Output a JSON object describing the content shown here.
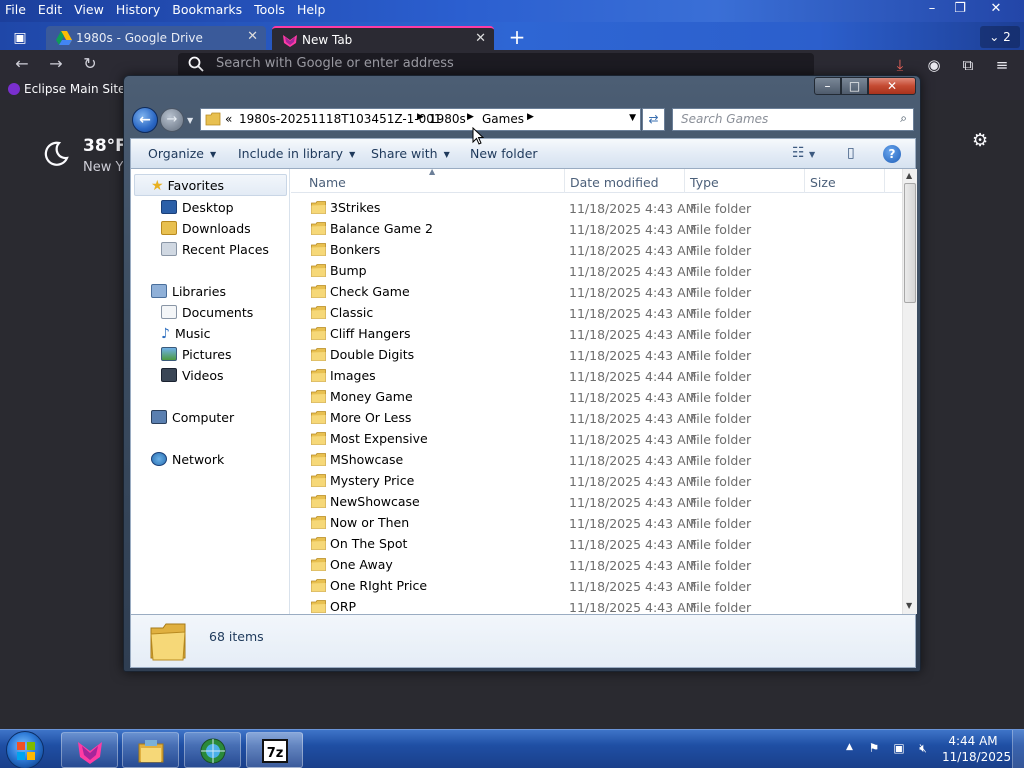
{
  "browser": {
    "menus": [
      "File",
      "Edit",
      "View",
      "History",
      "Bookmarks",
      "Tools",
      "Help"
    ],
    "tabs": [
      {
        "title": "1980s - Google Drive",
        "icon": "google-drive-icon",
        "active": false
      },
      {
        "title": "New Tab",
        "icon": "firefox-icon",
        "active": true
      }
    ],
    "tab_count": "2",
    "url_placeholder": "Search with Google or enter address",
    "bookmark": "Eclipse Main Site",
    "weather": {
      "temp": "38°F",
      "city": "New Y"
    },
    "accent_color": "#ff3ba4"
  },
  "explorer": {
    "breadcrumb": {
      "overflow": "«",
      "parts": [
        "1980s-20251118T103451Z-1-001",
        "1980s",
        "Games"
      ]
    },
    "search_placeholder": "Search Games",
    "commands": {
      "organize": "Organize",
      "include": "Include in library",
      "share": "Share with",
      "new_folder": "New folder"
    },
    "nav": {
      "favorites": "Favorites",
      "desktop": "Desktop",
      "downloads": "Downloads",
      "recent": "Recent Places",
      "libraries": "Libraries",
      "documents": "Documents",
      "music": "Music",
      "pictures": "Pictures",
      "videos": "Videos",
      "computer": "Computer",
      "network": "Network"
    },
    "columns": {
      "name": "Name",
      "date": "Date modified",
      "type": "Type",
      "size": "Size"
    },
    "files": [
      {
        "name": "3Strikes",
        "date": "11/18/2025 4:43 AM",
        "type": "File folder"
      },
      {
        "name": "Balance Game 2",
        "date": "11/18/2025 4:43 AM",
        "type": "File folder"
      },
      {
        "name": "Bonkers",
        "date": "11/18/2025 4:43 AM",
        "type": "File folder"
      },
      {
        "name": "Bump",
        "date": "11/18/2025 4:43 AM",
        "type": "File folder"
      },
      {
        "name": "Check Game",
        "date": "11/18/2025 4:43 AM",
        "type": "File folder"
      },
      {
        "name": "Classic",
        "date": "11/18/2025 4:43 AM",
        "type": "File folder"
      },
      {
        "name": "Cliff Hangers",
        "date": "11/18/2025 4:43 AM",
        "type": "File folder"
      },
      {
        "name": "Double Digits",
        "date": "11/18/2025 4:43 AM",
        "type": "File folder"
      },
      {
        "name": "Images",
        "date": "11/18/2025 4:44 AM",
        "type": "File folder"
      },
      {
        "name": "Money Game",
        "date": "11/18/2025 4:43 AM",
        "type": "File folder"
      },
      {
        "name": "More Or Less",
        "date": "11/18/2025 4:43 AM",
        "type": "File folder"
      },
      {
        "name": "Most Expensive",
        "date": "11/18/2025 4:43 AM",
        "type": "File folder"
      },
      {
        "name": "MShowcase",
        "date": "11/18/2025 4:43 AM",
        "type": "File folder"
      },
      {
        "name": "Mystery Price",
        "date": "11/18/2025 4:43 AM",
        "type": "File folder"
      },
      {
        "name": "NewShowcase",
        "date": "11/18/2025 4:43 AM",
        "type": "File folder"
      },
      {
        "name": "Now or Then",
        "date": "11/18/2025 4:43 AM",
        "type": "File folder"
      },
      {
        "name": "On The Spot",
        "date": "11/18/2025 4:43 AM",
        "type": "File folder"
      },
      {
        "name": "One Away",
        "date": "11/18/2025 4:43 AM",
        "type": "File folder"
      },
      {
        "name": "One RIght Price",
        "date": "11/18/2025 4:43 AM",
        "type": "File folder"
      },
      {
        "name": "ORP",
        "date": "11/18/2025 4:43 AM",
        "type": "File folder"
      }
    ],
    "item_count": "68 items"
  },
  "taskbar": {
    "apps": [
      "firefox-icon",
      "file-explorer-icon",
      "network-globe-icon",
      "7zip-icon"
    ],
    "time": "4:44 AM",
    "date": "11/18/2025"
  }
}
